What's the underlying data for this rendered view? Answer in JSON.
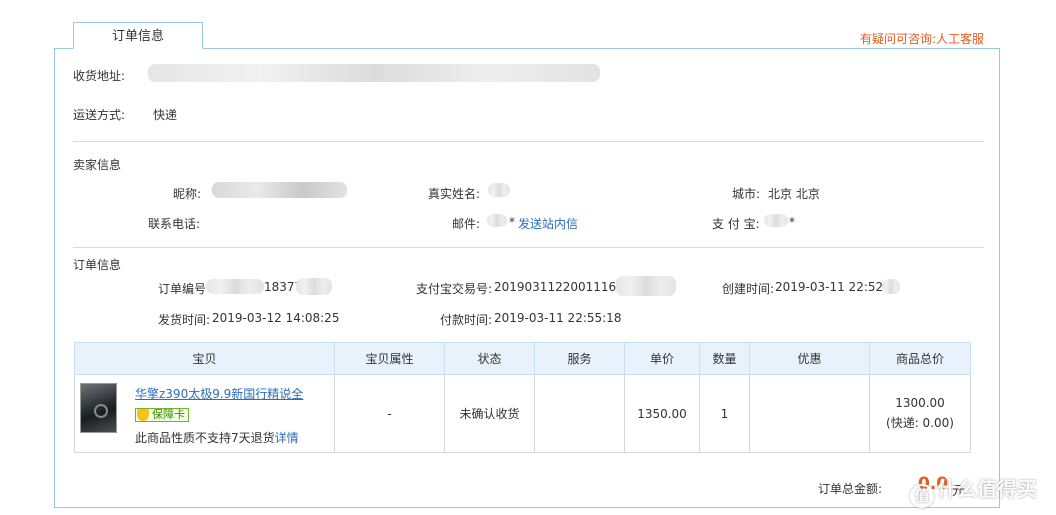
{
  "header": {
    "tab_label": "订单信息",
    "help_text": "有疑问可咨询:人工客服"
  },
  "shipping": {
    "address_label": "收货地址:",
    "method_label": "运送方式:",
    "method_value": "快递"
  },
  "seller": {
    "section_title": "卖家信息",
    "nickname_label": "昵称:",
    "realname_label": "真实姓名:",
    "city_label": "城市:",
    "city_value": "北京 北京",
    "phone_label": "联系电话:",
    "email_label": "邮件:",
    "email_suffix": "*",
    "message_link": "发送站内信",
    "alipay_label": "支 付 宝:",
    "alipay_suffix": "*"
  },
  "order": {
    "section_title": "订单信息",
    "number_label": "订单编号",
    "number_partial": "18377",
    "alipay_trade_label": "支付宝交易号:",
    "alipay_trade_value": "201903112200111640",
    "created_label": "创建时间:",
    "created_value": "2019-03-11 22:52:5",
    "shipped_label": "发货时间:",
    "shipped_value": "2019-03-12 14:08:25",
    "paid_label": "付款时间:",
    "paid_value": "2019-03-11 22:55:18"
  },
  "table": {
    "headers": [
      "宝贝",
      "宝贝属性",
      "状态",
      "服务",
      "单价",
      "数量",
      "优惠",
      "商品总价"
    ],
    "row": {
      "title": "华擎z390太极9.9新国行精说全",
      "badge": "保障卡",
      "note": "此商品性质不支持7天退货",
      "detail_link": "详情",
      "attributes": "-",
      "status": "未确认收货",
      "service": "",
      "unit_price": "1350.00",
      "quantity": "1",
      "discount": "",
      "total": "1300.00",
      "shipping_note": "(快递: 0.00)"
    }
  },
  "summary": {
    "total_label": "订单总金额:",
    "total_value": "0.0",
    "unit": "元"
  },
  "watermark": {
    "text": "什么值得买",
    "icon": "值"
  },
  "colors": {
    "accent_orange": "#e55b1b",
    "link_blue": "#2a6ebb",
    "border_blue": "#9ac6e8",
    "header_bg": "#e8f2fc"
  }
}
